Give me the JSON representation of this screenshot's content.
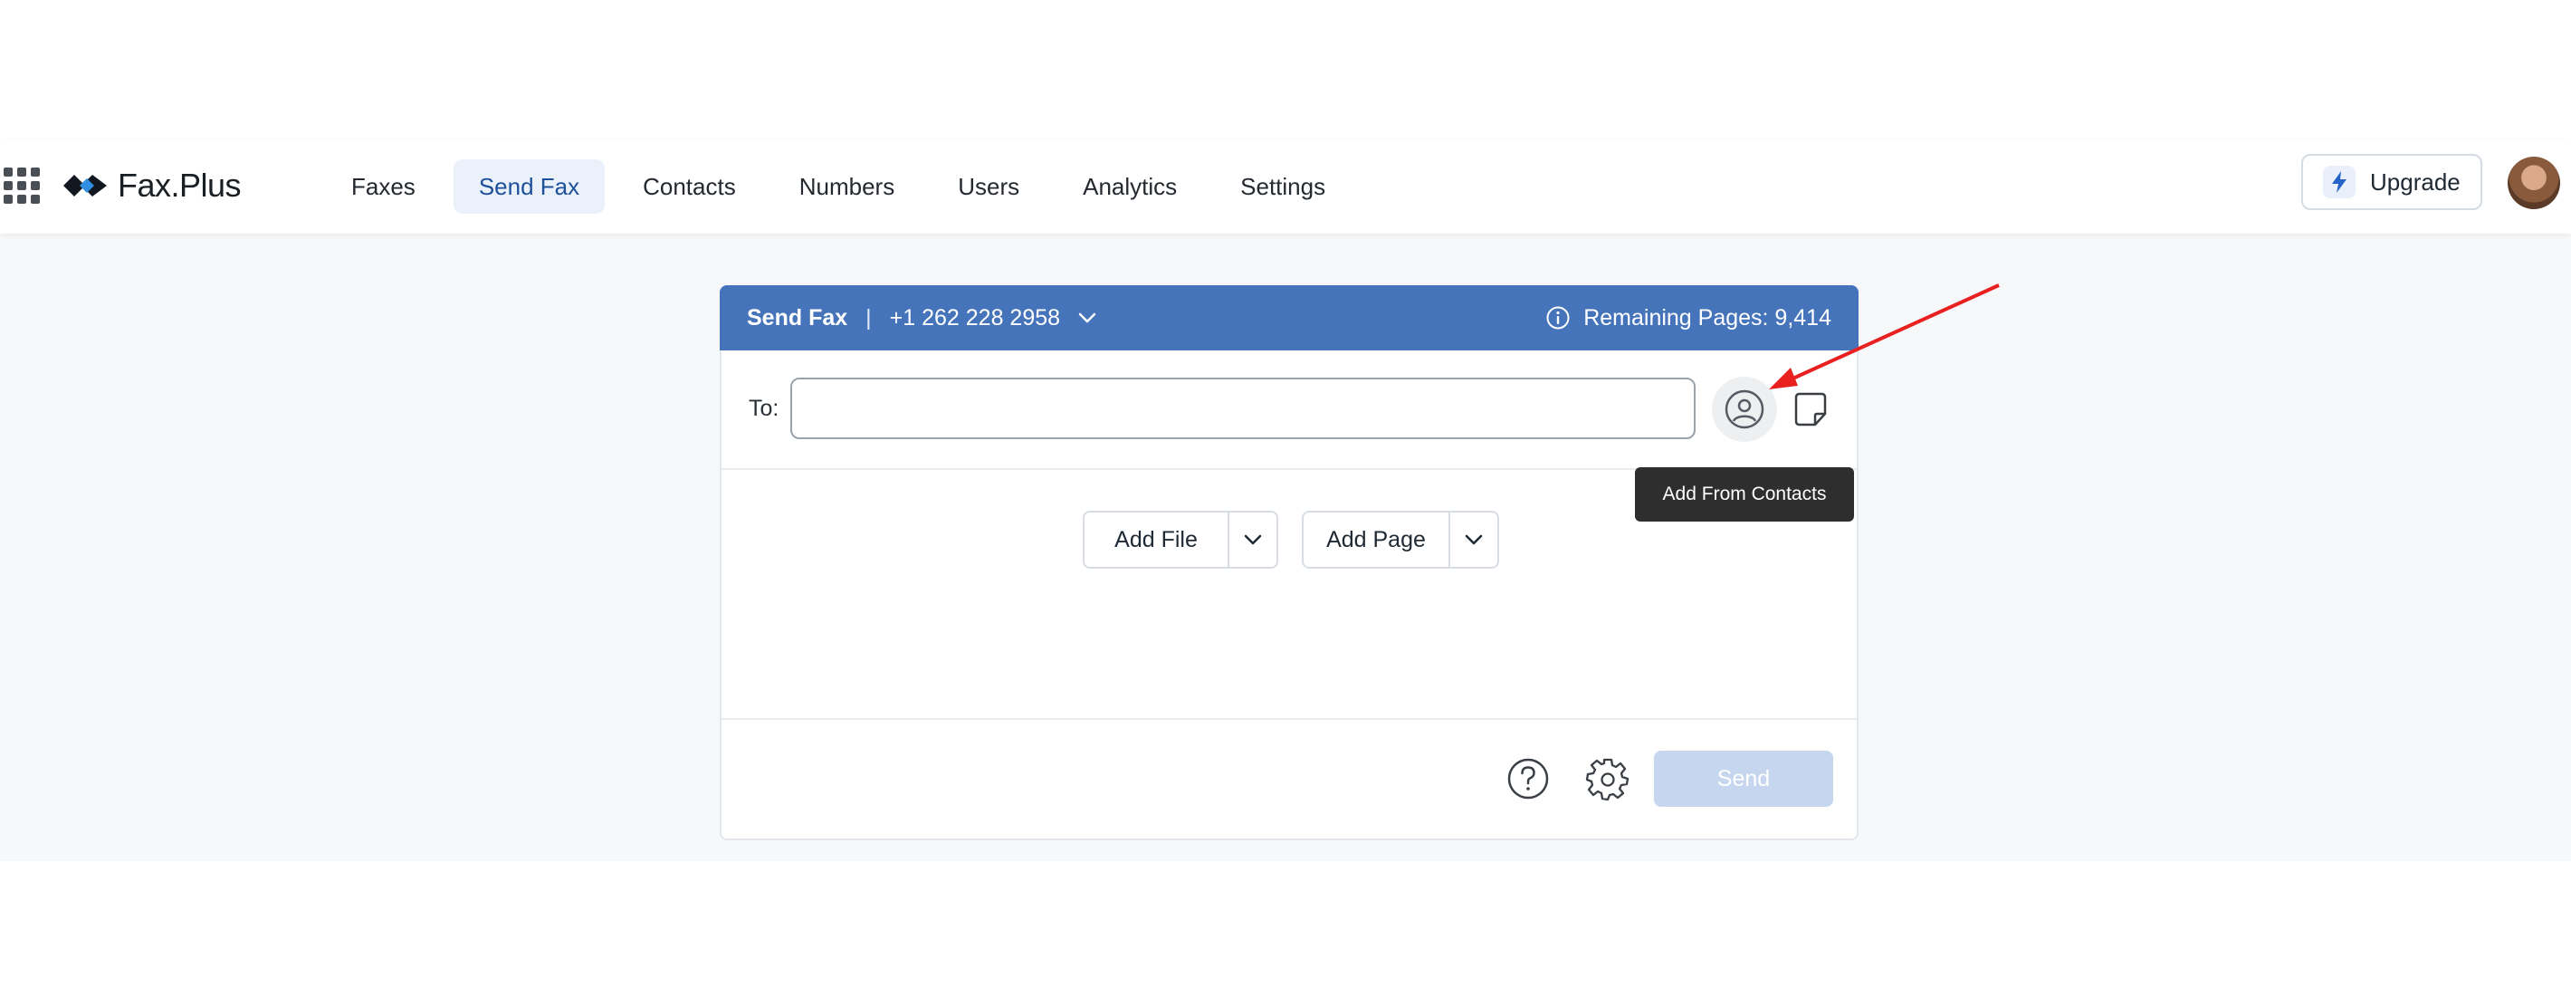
{
  "app": {
    "logo_text": "Fax.Plus"
  },
  "nav": {
    "items": [
      {
        "label": "Faxes",
        "active": false
      },
      {
        "label": "Send Fax",
        "active": true
      },
      {
        "label": "Contacts",
        "active": false
      },
      {
        "label": "Numbers",
        "active": false
      },
      {
        "label": "Users",
        "active": false
      },
      {
        "label": "Analytics",
        "active": false
      },
      {
        "label": "Settings",
        "active": false
      }
    ],
    "upgrade_label": "Upgrade"
  },
  "card": {
    "title": "Send Fax",
    "separator": "|",
    "number": "+1 262 228 2958",
    "remaining_pages": "Remaining Pages: 9,414",
    "to_label": "To:",
    "to_value": "",
    "add_file_label": "Add File",
    "add_page_label": "Add Page",
    "send_label": "Send"
  },
  "tooltip": {
    "text": "Add From Contacts"
  },
  "colors": {
    "header_bg": "#4574bb",
    "nav_active_bg": "#eaf1fb",
    "send_disabled": "#c6d6ee",
    "annotation_arrow": "#e8201f"
  },
  "icons": [
    "apps-grid-icon",
    "logo-icon",
    "bolt-icon",
    "avatar",
    "chevron-down-icon",
    "info-icon",
    "contact-icon",
    "note-icon",
    "help-icon",
    "gear-icon"
  ]
}
